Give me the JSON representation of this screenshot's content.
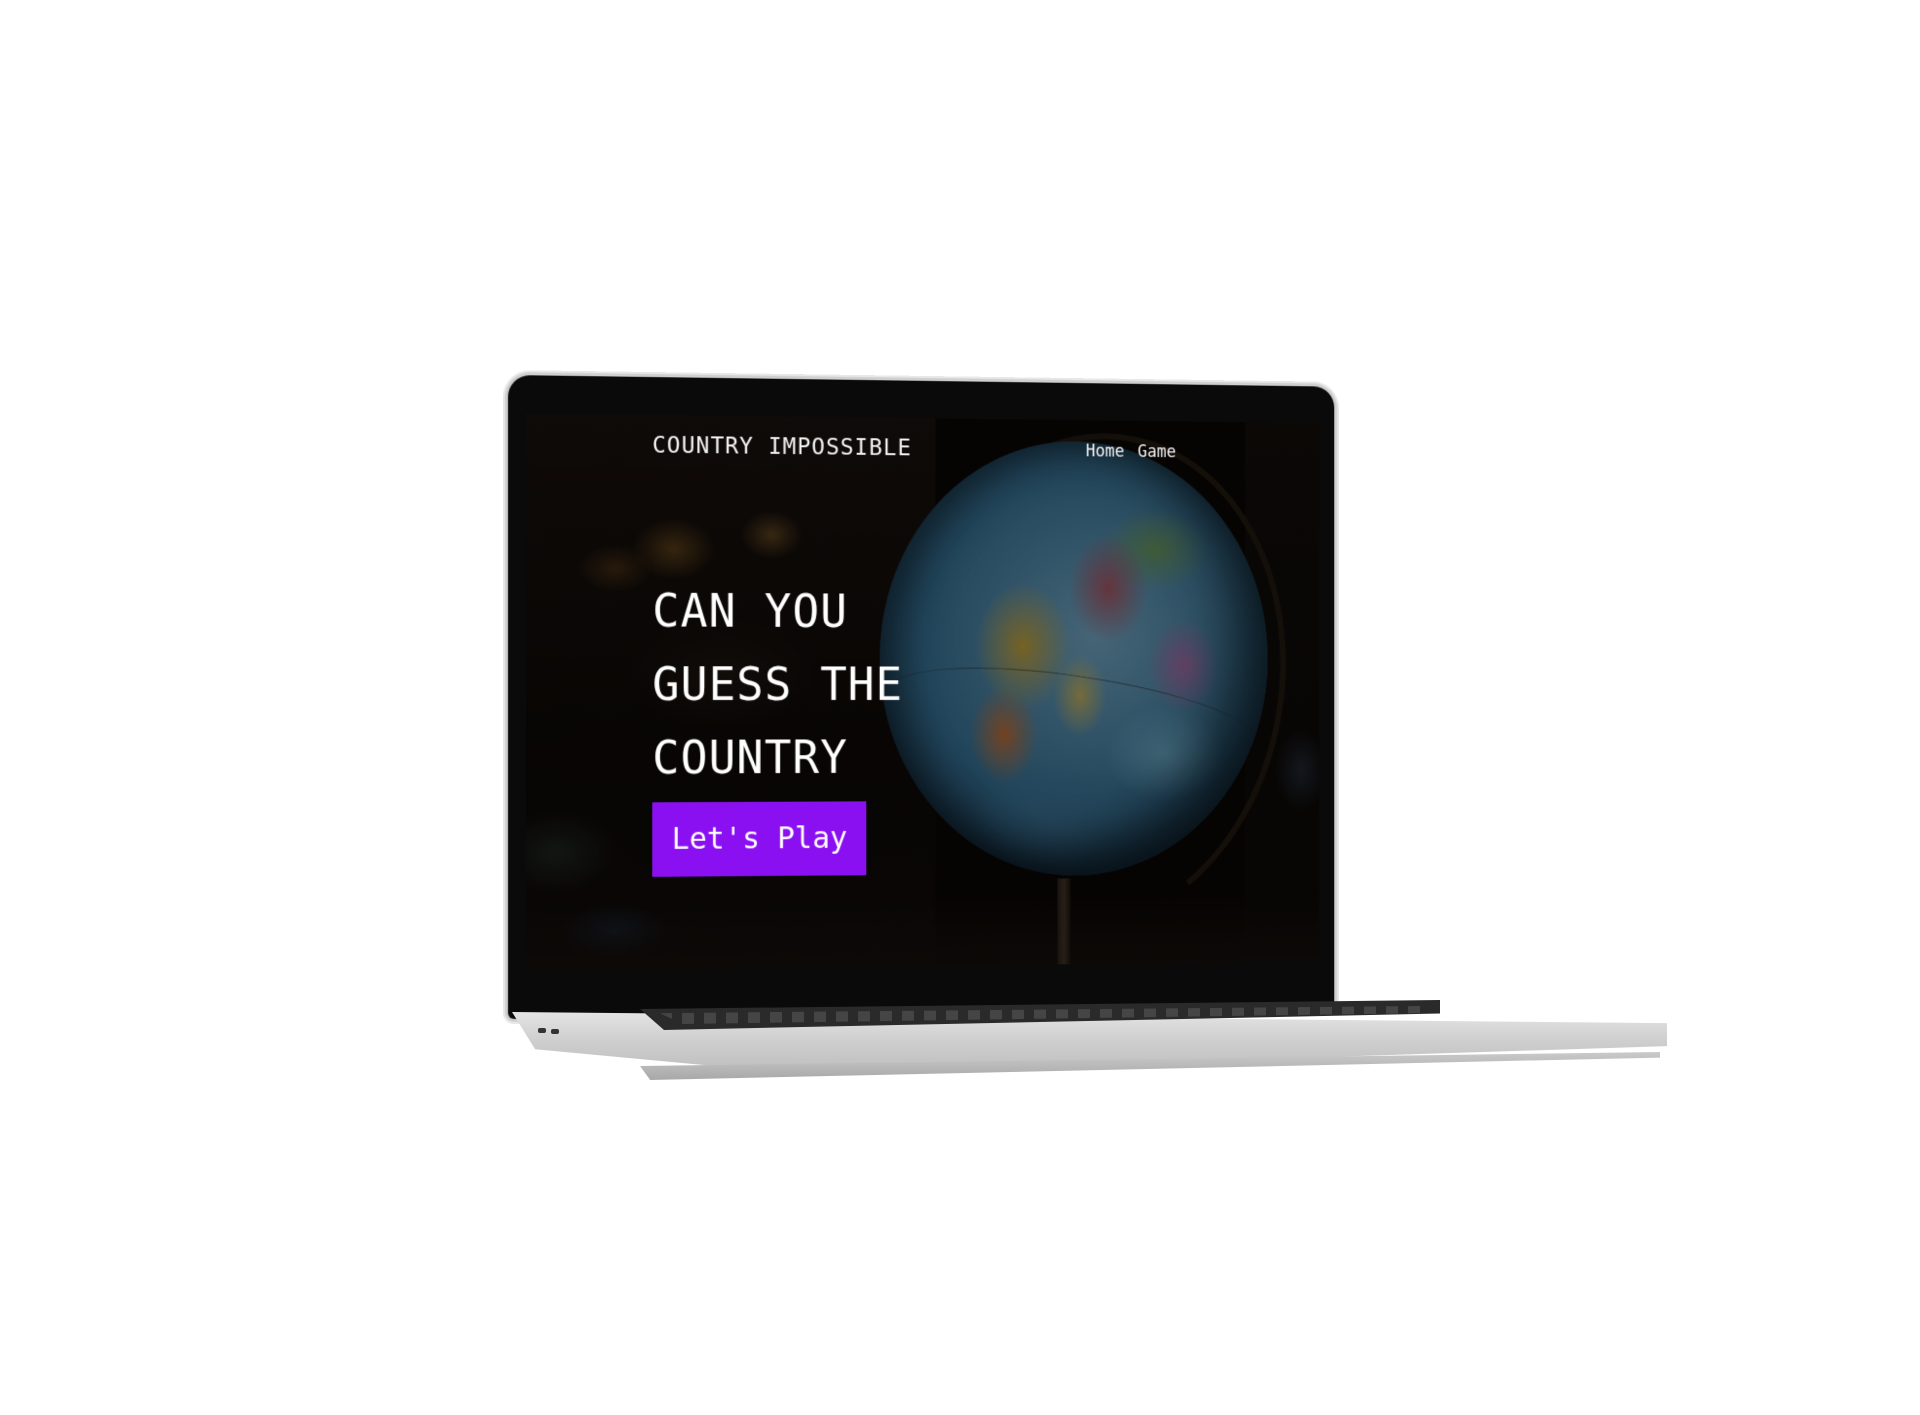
{
  "app": {
    "brand": "COUNTRY IMPOSSIBLE"
  },
  "nav": {
    "items": [
      {
        "label": "Home"
      },
      {
        "label": "Game"
      }
    ]
  },
  "hero": {
    "title_lines": [
      "CAN YOU",
      "GUESS THE",
      "COUNTRY"
    ],
    "cta_label": "Let's Play"
  },
  "colors": {
    "accent": "#8a10f2",
    "page_background": "#ffffff",
    "screen_text": "#ffffff"
  },
  "icons": {
    "hero_image": "globe-photo"
  }
}
